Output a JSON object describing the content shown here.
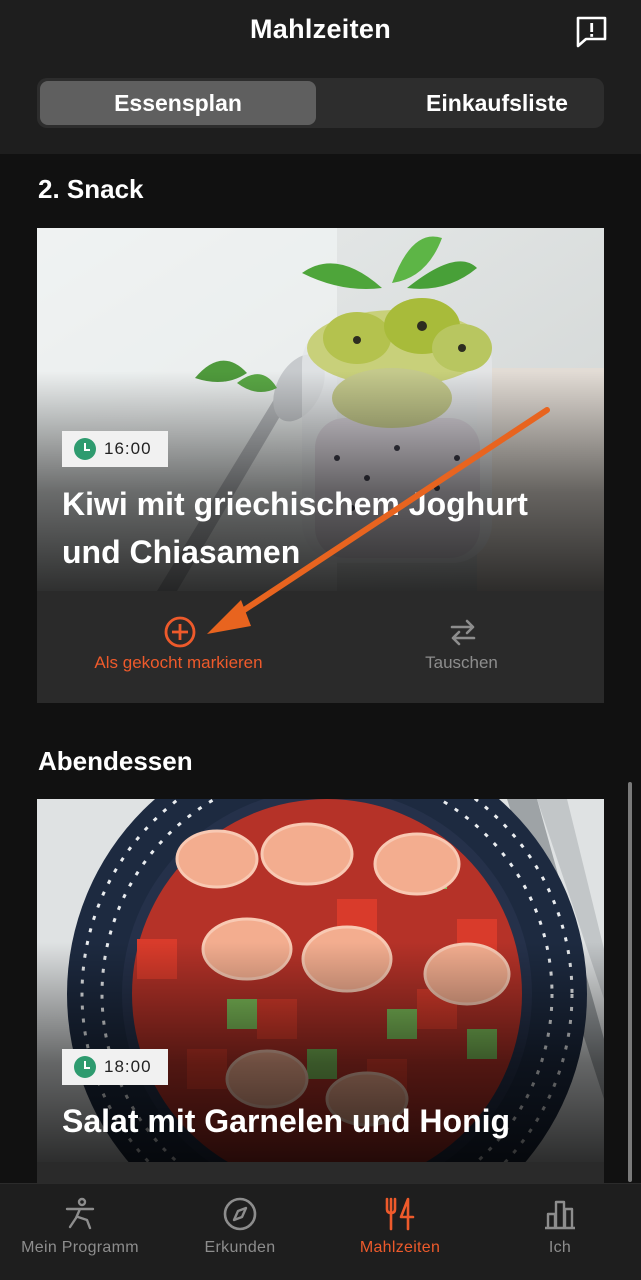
{
  "header": {
    "title": "Mahlzeiten",
    "feedback_icon": "feedback-icon"
  },
  "segments": {
    "plan": "Essensplan",
    "shopping": "Einkaufsliste",
    "selected": "Essensplan"
  },
  "meals": [
    {
      "section": "2. Snack",
      "time": "16:00",
      "name": "Kiwi mit griechischem Joghurt und Chiasamen",
      "image": "kiwi-yogurt-jar-photo",
      "actions": {
        "cook": "Als gekocht markieren",
        "swap": "Tauschen"
      }
    },
    {
      "section": "Abendessen",
      "time": "18:00",
      "name": "Salat mit Garnelen und Honig",
      "image": "shrimp-salad-photo"
    }
  ],
  "tabbar": {
    "items": [
      {
        "label": "Mein Programm",
        "icon": "exercise-icon"
      },
      {
        "label": "Erkunden",
        "icon": "compass-icon"
      },
      {
        "label": "Mahlzeiten",
        "icon": "cutlery-icon"
      },
      {
        "label": "Ich",
        "icon": "chart-icon"
      }
    ],
    "active": "Mahlzeiten"
  },
  "colors": {
    "accent": "#ee5a2b",
    "clock": "#2e9b6f",
    "background": "#111111",
    "header": "#1e1e1e"
  }
}
